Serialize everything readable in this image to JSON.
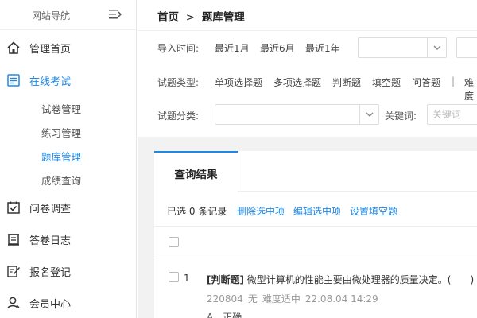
{
  "sidebar": {
    "title": "网站导航",
    "items": [
      {
        "label": "管理首页",
        "icon": "home-icon"
      },
      {
        "label": "在线考试",
        "icon": "list-icon"
      },
      {
        "label": "问卷调查",
        "icon": "checkbox-icon"
      },
      {
        "label": "答卷日志",
        "icon": "log-icon"
      },
      {
        "label": "报名登记",
        "icon": "pen-icon"
      },
      {
        "label": "会员中心",
        "icon": "user-icon"
      }
    ],
    "subitems": [
      "试卷管理",
      "练习管理",
      "题库管理",
      "成绩查询"
    ]
  },
  "breadcrumb": {
    "home": "首页",
    "sep": ">",
    "current": "题库管理"
  },
  "filters": {
    "import_label": "导入时间:",
    "import_opts": [
      "最近1月",
      "最近6月",
      "最近1年"
    ],
    "type_label": "试题类型:",
    "type_opts": [
      "单项选择题",
      "多项选择题",
      "判断题",
      "填空题",
      "问答题"
    ],
    "type_sep": "|",
    "type_more": "难度",
    "cat_label": "试题分类:",
    "kw_label": "关键词:",
    "kw_placeholder": "关键词"
  },
  "results": {
    "tab": "查询结果",
    "selected": "已选 0 条记录",
    "actions": [
      "删除选中项",
      "编辑选中项",
      "设置填空题"
    ],
    "row": {
      "num": "1",
      "type": "[判断题]",
      "text": " 微型计算机的性能主要由微处理器的质量决定。(　　)",
      "meta": [
        "220804",
        "无",
        "难度适中",
        "22.08.04 14:29"
      ],
      "option": "A．正确"
    }
  },
  "colors": {
    "accent": "#1e88e5"
  }
}
